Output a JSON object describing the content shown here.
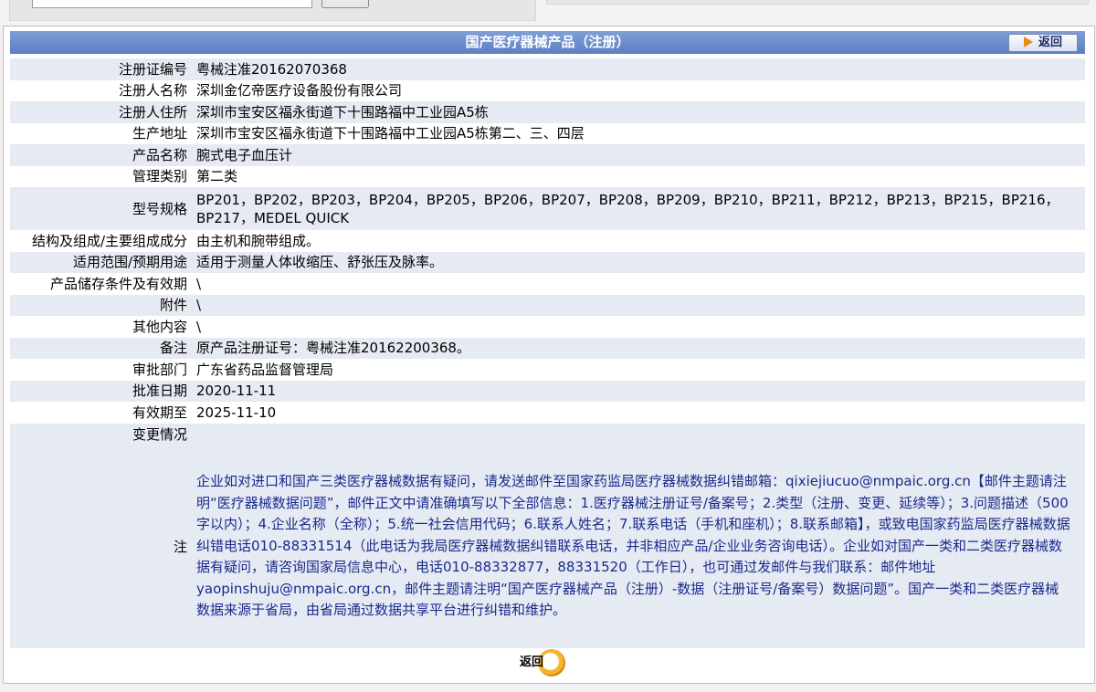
{
  "header": {
    "title": "国产医疗器械产品（注册）",
    "back_label": "返回"
  },
  "fields": [
    {
      "label": "注册证编号",
      "value": "粤械注准20162070368"
    },
    {
      "label": "注册人名称",
      "value": "深圳金亿帝医疗设备股份有限公司"
    },
    {
      "label": "注册人住所",
      "value": "深圳市宝安区福永街道下十围路福中工业园A5栋"
    },
    {
      "label": "生产地址",
      "value": "深圳市宝安区福永街道下十围路福中工业园A5栋第二、三、四层"
    },
    {
      "label": "产品名称",
      "value": "腕式电子血压计"
    },
    {
      "label": "管理类别",
      "value": "第二类"
    },
    {
      "label": "型号规格",
      "value": "BP201，BP202，BP203，BP204，BP205，BP206，BP207，BP208，BP209，BP210，BP211，BP212，BP213，BP215，BP216，BP217，MEDEL QUICK"
    },
    {
      "label": "结构及组成/主要组成成分",
      "value": "由主机和腕带组成。"
    },
    {
      "label": "适用范围/预期用途",
      "value": "适用于测量人体收缩压、舒张压及脉率。"
    },
    {
      "label": "产品储存条件及有效期",
      "value": "\\"
    },
    {
      "label": "附件",
      "value": "\\"
    },
    {
      "label": "其他内容",
      "value": "\\"
    },
    {
      "label": "备注",
      "value": "原产品注册证号：粤械注准20162200368。"
    },
    {
      "label": "审批部门",
      "value": "广东省药品监督管理局"
    },
    {
      "label": "批准日期",
      "value": "2020-11-11"
    },
    {
      "label": "有效期至",
      "value": "2025-11-10"
    },
    {
      "label": "变更情况",
      "value": ""
    }
  ],
  "note": {
    "label": "注",
    "text": "企业如对进口和国产三类医疗器械数据有疑问，请发送邮件至国家药监局医疗器械数据纠错邮箱：qixiejiucuo@nmpaic.org.cn【邮件主题请注明“医疗器械数据问题”，邮件正文中请准确填写以下全部信息：1.医疗器械注册证号/备案号；2.类型（注册、变更、延续等）；3.问题描述（500字以内）；4.企业名称（全称）；5.统一社会信用代码；6.联系人姓名；7.联系电话（手机和座机）；8.联系邮箱】，或致电国家药监局医疗器械数据纠错电话010-88331514（此电话为我局医疗器械数据纠错联系电话，并非相应产品/企业业务咨询电话）。企业如对国产一类和二类医疗器械数据有疑问，请咨询国家局信息中心，电话010-88332877，88331520（工作日），也可通过发邮件与我们联系：邮件地址yaopinshuju@nmpaic.org.cn，邮件主题请注明“国产医疗器械产品（注册）-数据（注册证号/备案号）数据问题”。国产一类和二类医疗器械数据来源于省局，由省局通过数据共享平台进行纠错和维护。"
  },
  "footer": {
    "back_label": "返回"
  },
  "colors": {
    "title_bar": "#5b7fc2",
    "row_alt": "#e6eaf3",
    "note_text": "#1a2a8c",
    "back_ring": "#f4b52c"
  }
}
